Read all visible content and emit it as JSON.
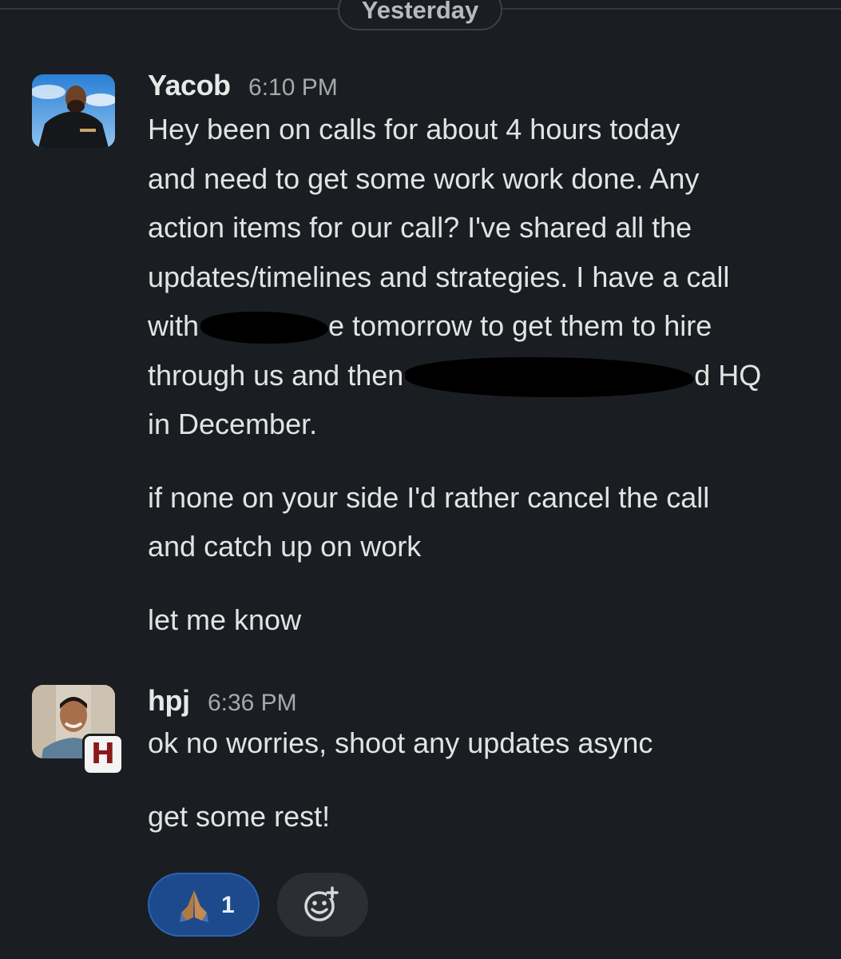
{
  "divider": {
    "label": "Yesterday"
  },
  "messages": [
    {
      "sender": "Yacob",
      "time": "6:10 PM",
      "lines": {
        "l1": "Hey been on calls for about 4 hours today",
        "l2": "and need to get some work work done. Any",
        "l3": "action items for our call? I've shared all the",
        "l4": "updates/timelines and strategies. I have a call",
        "l5a": "with ",
        "l5b": "e tomorrow to get them to hire",
        "l6a": "through us and then",
        "l6b": "d HQ",
        "l7": "in December."
      },
      "p2": {
        "l1": "if none on your side I'd rather cancel the call",
        "l2": "and catch up on work"
      },
      "p3": "let me know"
    },
    {
      "sender": "hpj",
      "time": "6:36 PM",
      "badge": "H",
      "p1": "ok no worries, shoot any updates async",
      "p2": "get some rest!"
    }
  ],
  "reactions": [
    {
      "emoji_icon": "folded-hands-icon",
      "count": "1",
      "selected_color": "#1d4a8c"
    }
  ],
  "add_reaction": {
    "icon": "add-emoji-icon"
  }
}
